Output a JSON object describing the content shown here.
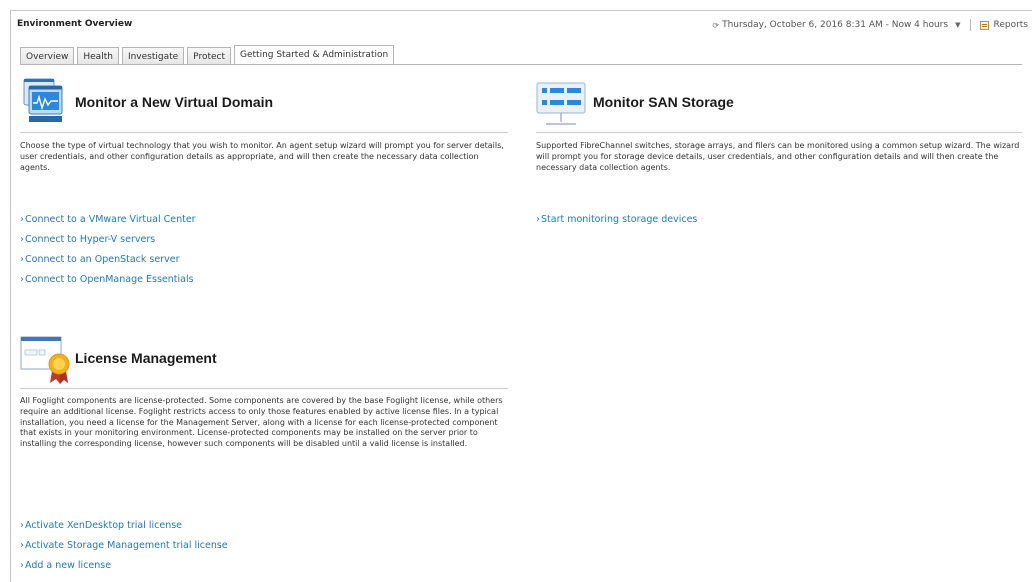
{
  "header": {
    "title": "Environment Overview",
    "time_range": "Thursday, October 6, 2016 8:31 AM - Now 4 hours",
    "reports_label": "Reports"
  },
  "tabs": [
    {
      "label": "Overview"
    },
    {
      "label": "Health"
    },
    {
      "label": "Investigate"
    },
    {
      "label": "Protect"
    },
    {
      "label": "Getting Started & Administration"
    }
  ],
  "virtual": {
    "title": "Monitor a New Virtual Domain",
    "description": "Choose the type of virtual technology that you wish to monitor. An agent setup wizard will prompt you for server details, user credentials, and other configuration details as appropriate, and will then create the necessary data collection agents.",
    "links": [
      "Connect to a VMware Virtual Center",
      "Connect to Hyper-V servers",
      "Connect to an OpenStack server",
      "Connect to OpenManage Essentials"
    ]
  },
  "san": {
    "title": "Monitor SAN Storage",
    "description": "Supported FibreChannel switches, storage arrays, and filers can be monitored using a common setup wizard. The wizard will prompt you for storage device details, user credentials, and other configuration details and will then create the necessary data collection agents.",
    "links": [
      "Start monitoring storage devices"
    ]
  },
  "license": {
    "title": "License Management",
    "description": "All Foglight components are license-protected. Some components are covered by the base Foglight license, while others require an additional license. Foglight restricts access to only those features enabled by active license files. In a typical installation, you need a license for the Management Server, along with a license for each license-protected component that exists in your monitoring environment. License-protected components may be installed on the server prior to installing the corresponding license, however such components will be disabled until a valid license is installed.",
    "links": [
      "Activate XenDesktop trial license",
      "Activate Storage Management trial license",
      "Add a new license"
    ]
  },
  "colors": {
    "link": "#1f7ab8",
    "accent_blue": "#2a7fd0",
    "gold": "#f2b01e"
  },
  "icons": {
    "time": "refresh-icon",
    "dropdown": "caret-down-icon",
    "link_bullet": "chevron-right-icon"
  }
}
